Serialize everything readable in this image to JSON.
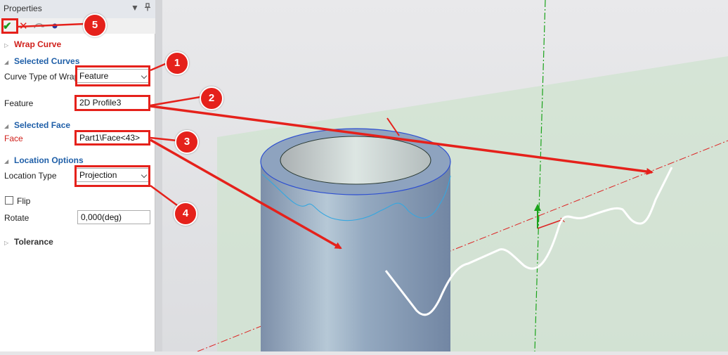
{
  "panel": {
    "title": "Properties",
    "pin_icon": "pin-icon",
    "dropdown_icon": "dropdown-triangle-icon"
  },
  "toolbar": {
    "ok_icon": "checkmark-icon",
    "cancel_icon": "x-icon",
    "apply_icon": "apply-icon",
    "preview_icon": "dot-icon",
    "ok_glyph": "✔",
    "cancel_glyph": "✕"
  },
  "sections": {
    "wrap_curve": "Wrap Curve",
    "selected_curves": "Selected Curves",
    "selected_face": "Selected Face",
    "location_options": "Location Options",
    "tolerance": "Tolerance"
  },
  "fields": {
    "curve_type_label": "Curve Type of Wrap",
    "curve_type_value": "Feature",
    "feature_label": "Feature",
    "feature_value": "2D Profile3",
    "face_label": "Face",
    "face_value": "Part1\\Face<43>",
    "location_type_label": "Location Type",
    "location_type_value": "Projection",
    "flip_label": "Flip",
    "rotate_label": "Rotate",
    "rotate_value": "0,000(deg)"
  },
  "callouts": [
    "1",
    "2",
    "3",
    "4",
    "5"
  ],
  "colors": {
    "accent_red": "#e5211b",
    "section_blue": "#1f5fa8",
    "wrap_red": "#d0201b",
    "cylinder": "#8fa3bd",
    "plane_green": "#cfe3cf"
  }
}
